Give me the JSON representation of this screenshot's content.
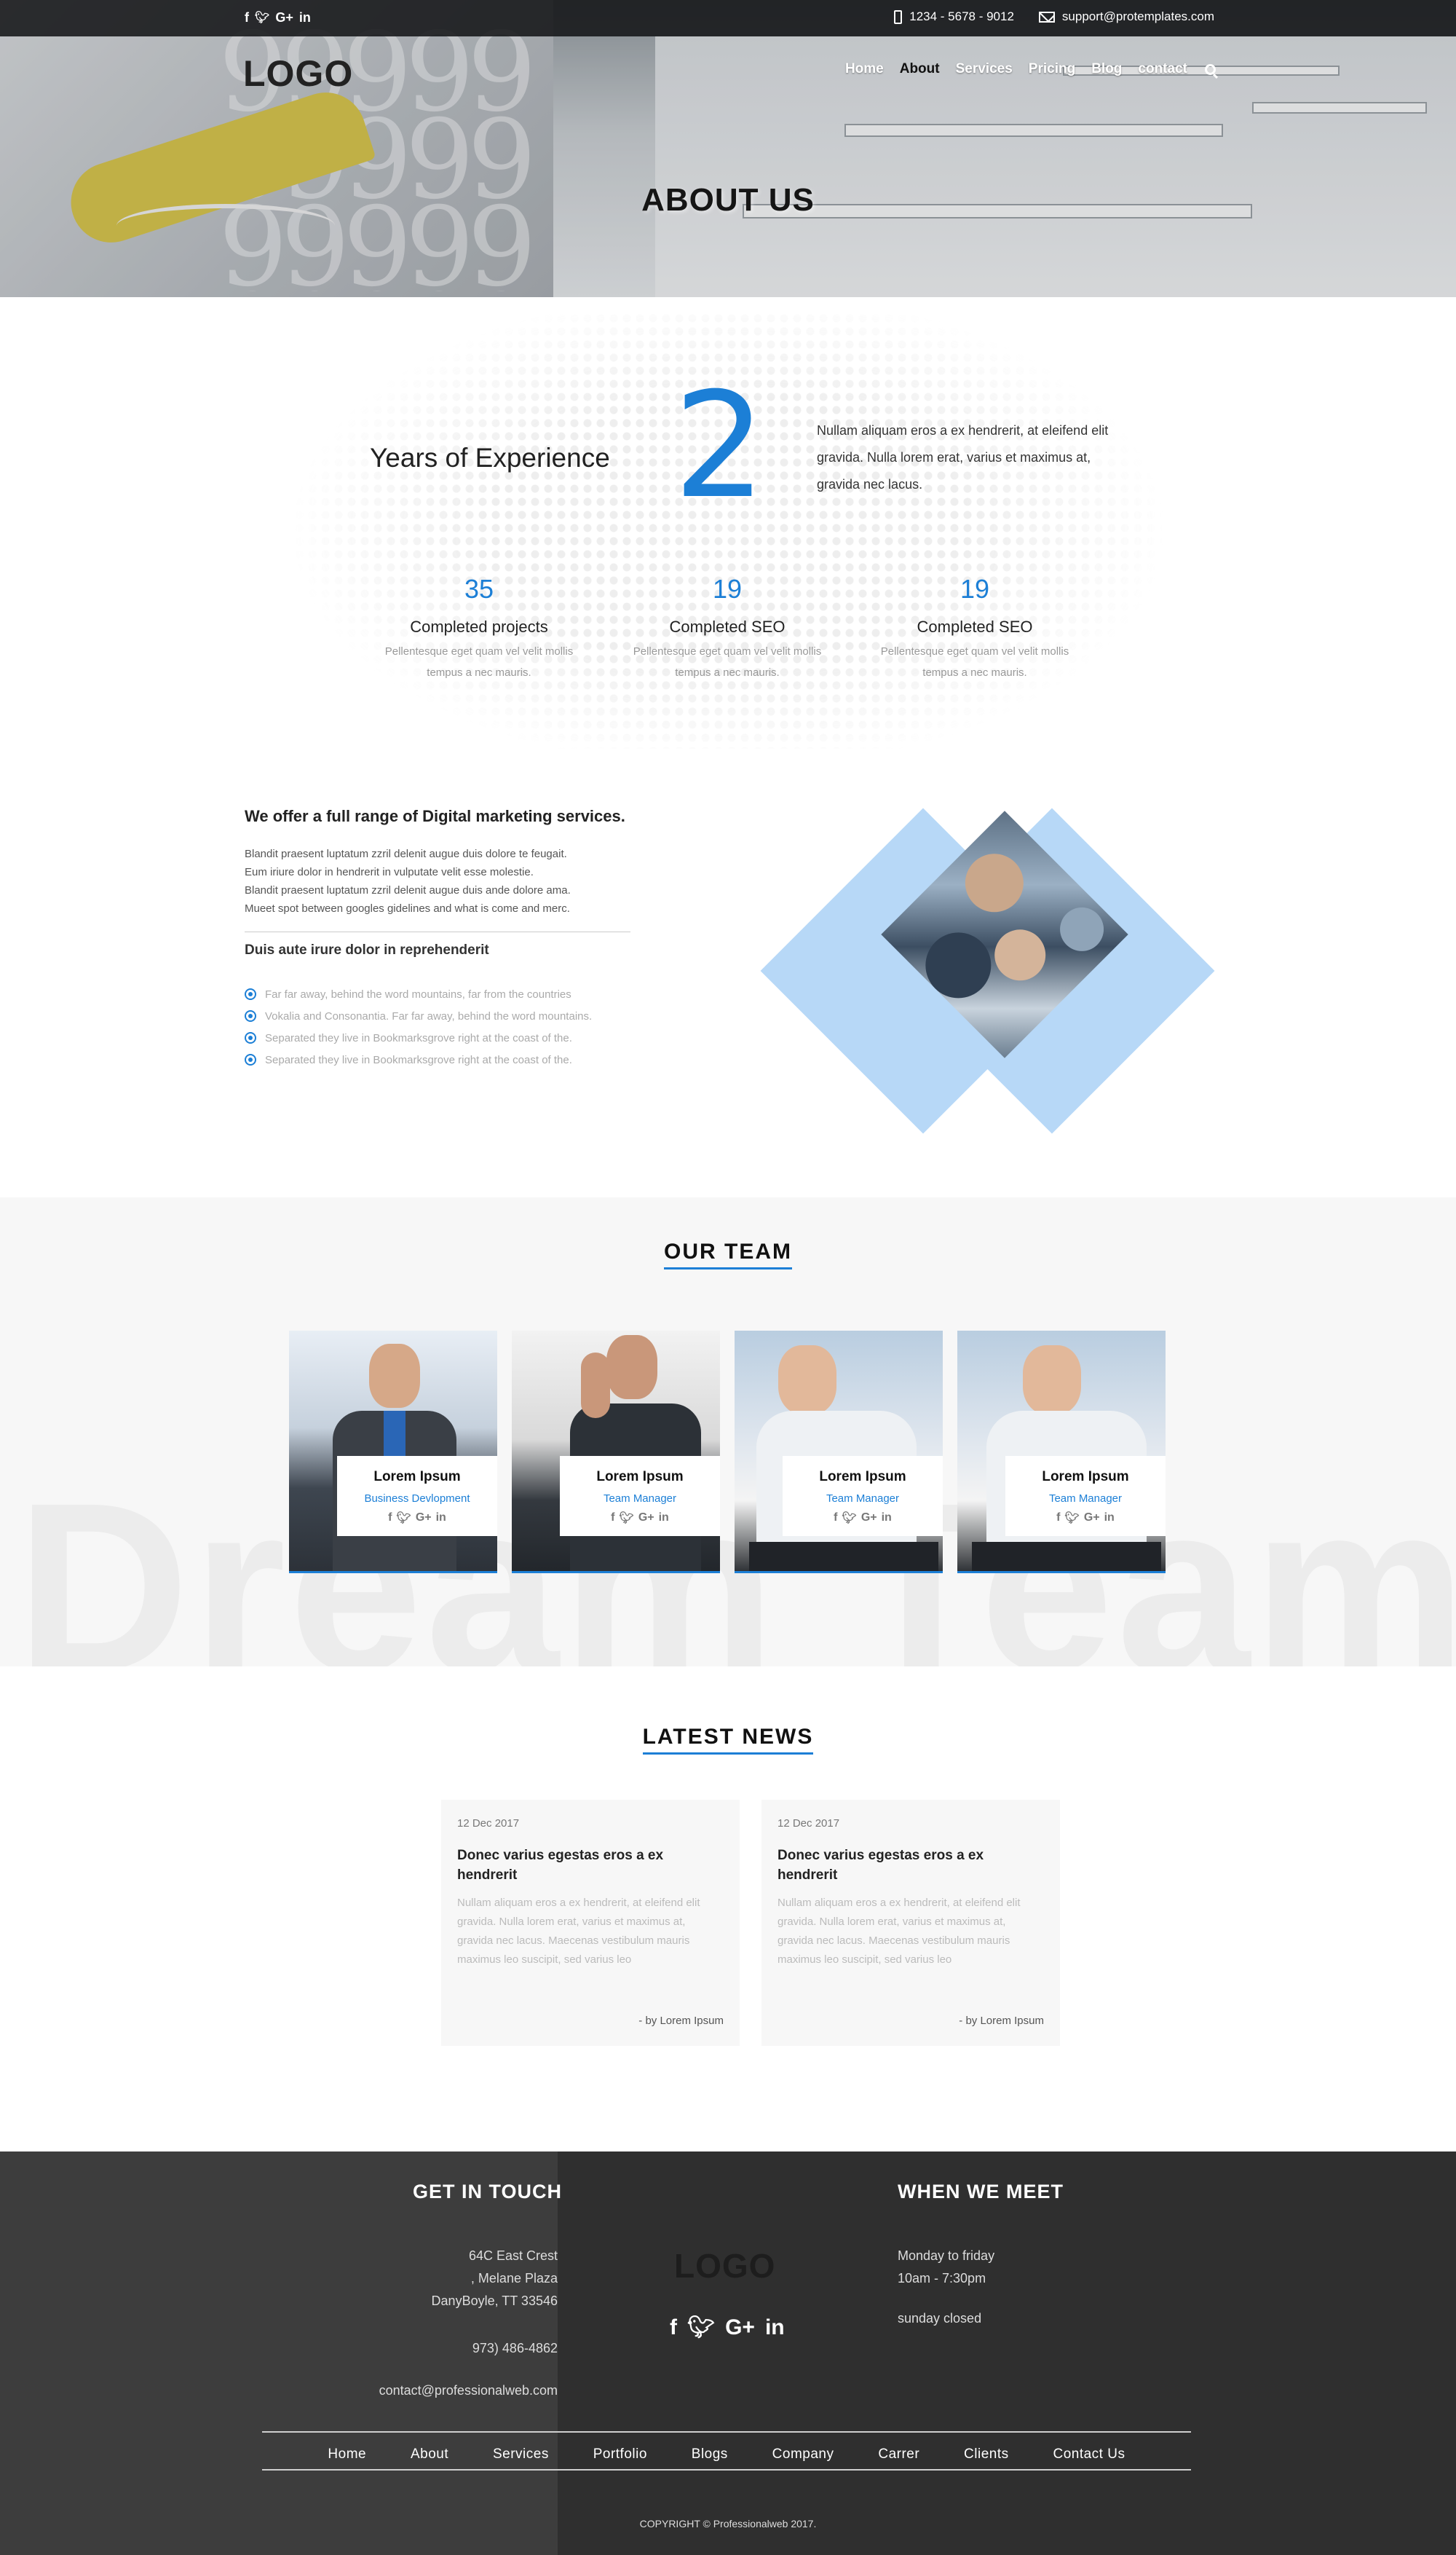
{
  "topbar": {
    "social_icons": [
      "facebook-icon",
      "twitter-icon",
      "google-plus-icon",
      "linkedin-icon"
    ],
    "social_glyphs": [
      "f",
      "🐦",
      "G+",
      "in"
    ],
    "phone": "1234 - 5678 - 9012",
    "email": "support@protemplates.com"
  },
  "nav": {
    "logo": "LOGO",
    "items": [
      "Home",
      "About",
      "Services",
      "Pricing",
      "Blog",
      "contact"
    ],
    "active": "About"
  },
  "hero": {
    "title": "ABOUT US"
  },
  "stats": {
    "experience_label": "Years of Experience",
    "experience_value": "2",
    "experience_text": "Nullam aliquam eros a ex hendrerit, at eleifend elit gravida. Nulla lorem erat, varius et maximus at, gravida nec lacus.",
    "counters": [
      {
        "value": "35",
        "title": "Completed projects",
        "desc": "Pellentesque eget quam vel velit mollis tempus a nec mauris."
      },
      {
        "value": "19",
        "title": "Completed SEO",
        "desc": "Pellentesque eget quam vel velit mollis tempus a nec mauris."
      },
      {
        "value": "19",
        "title": "Completed SEO",
        "desc": "Pellentesque eget quam vel velit mollis tempus a nec mauris."
      }
    ]
  },
  "services": {
    "title": "We offer a full range of Digital marketing services.",
    "lines": [
      "Blandit praesent luptatum zzril delenit augue duis dolore te feugait.",
      "Eum iriure dolor in hendrerit in vulputate velit esse molestie.",
      "Blandit praesent luptatum zzril delenit augue duis ande dolore ama.",
      "Mueet spot between googles gidelines and what is come and merc."
    ],
    "subtitle": "Duis aute irure dolor in reprehenderit",
    "list": [
      "Far far away, behind the word mountains, far from the countries",
      "Vokalia and Consonantia. Far far away, behind the word mountains.",
      "Separated they live in Bookmarksgrove right at the coast of the.",
      "Separated they live in Bookmarksgrove right at the coast of the."
    ]
  },
  "team": {
    "title": "OUR TEAM",
    "background_text": "Dream Team",
    "members": [
      {
        "name": "Lorem Ipsum",
        "role": "Business Devlopment"
      },
      {
        "name": "Lorem Ipsum",
        "role": "Team Manager"
      },
      {
        "name": "Lorem Ipsum",
        "role": "Team Manager"
      },
      {
        "name": "Lorem Ipsum",
        "role": "Team Manager"
      }
    ]
  },
  "news": {
    "title": "LATEST NEWS",
    "items": [
      {
        "date": "12 Dec 2017",
        "headline": "Donec varius egestas eros a ex hendrerit",
        "body": "Nullam aliquam eros a ex hendrerit, at eleifend elit gravida. Nulla lorem erat, varius et maximus at, gravida nec lacus. Maecenas vestibulum mauris maximus leo suscipit, sed varius leo",
        "byline": "- by  Lorem Ipsum"
      },
      {
        "date": "12 Dec 2017",
        "headline": "Donec varius egestas eros a ex hendrerit",
        "body": "Nullam aliquam eros a ex hendrerit, at eleifend elit gravida. Nulla lorem erat, varius et maximus at, gravida nec lacus. Maecenas vestibulum mauris maximus leo suscipit, sed varius leo",
        "byline": "- by  Lorem Ipsum"
      }
    ]
  },
  "footer": {
    "contact_heading": "GET IN TOUCH",
    "address": [
      "64C East Crest",
      ", Melane Plaza",
      "DanyBoyle, TT 33546"
    ],
    "phone": "973) 486-4862",
    "email": "contact@professionalweb.com",
    "logo": "LOGO",
    "meet_heading": "WHEN WE MEET",
    "hours": [
      "Monday to friday",
      "10am - 7:30pm"
    ],
    "closed": "sunday closed",
    "links": [
      "Home",
      "About",
      "Services",
      "Portfolio",
      "Blogs",
      "Company",
      "Carrer",
      "Clients",
      "Contact Us"
    ],
    "copyright": "COPYRIGHT © Professionalweb 2017."
  },
  "colors": {
    "accent": "#1c7fd6",
    "footer_dark": "#2f2f2f",
    "diamond": "#b7d8f7"
  }
}
